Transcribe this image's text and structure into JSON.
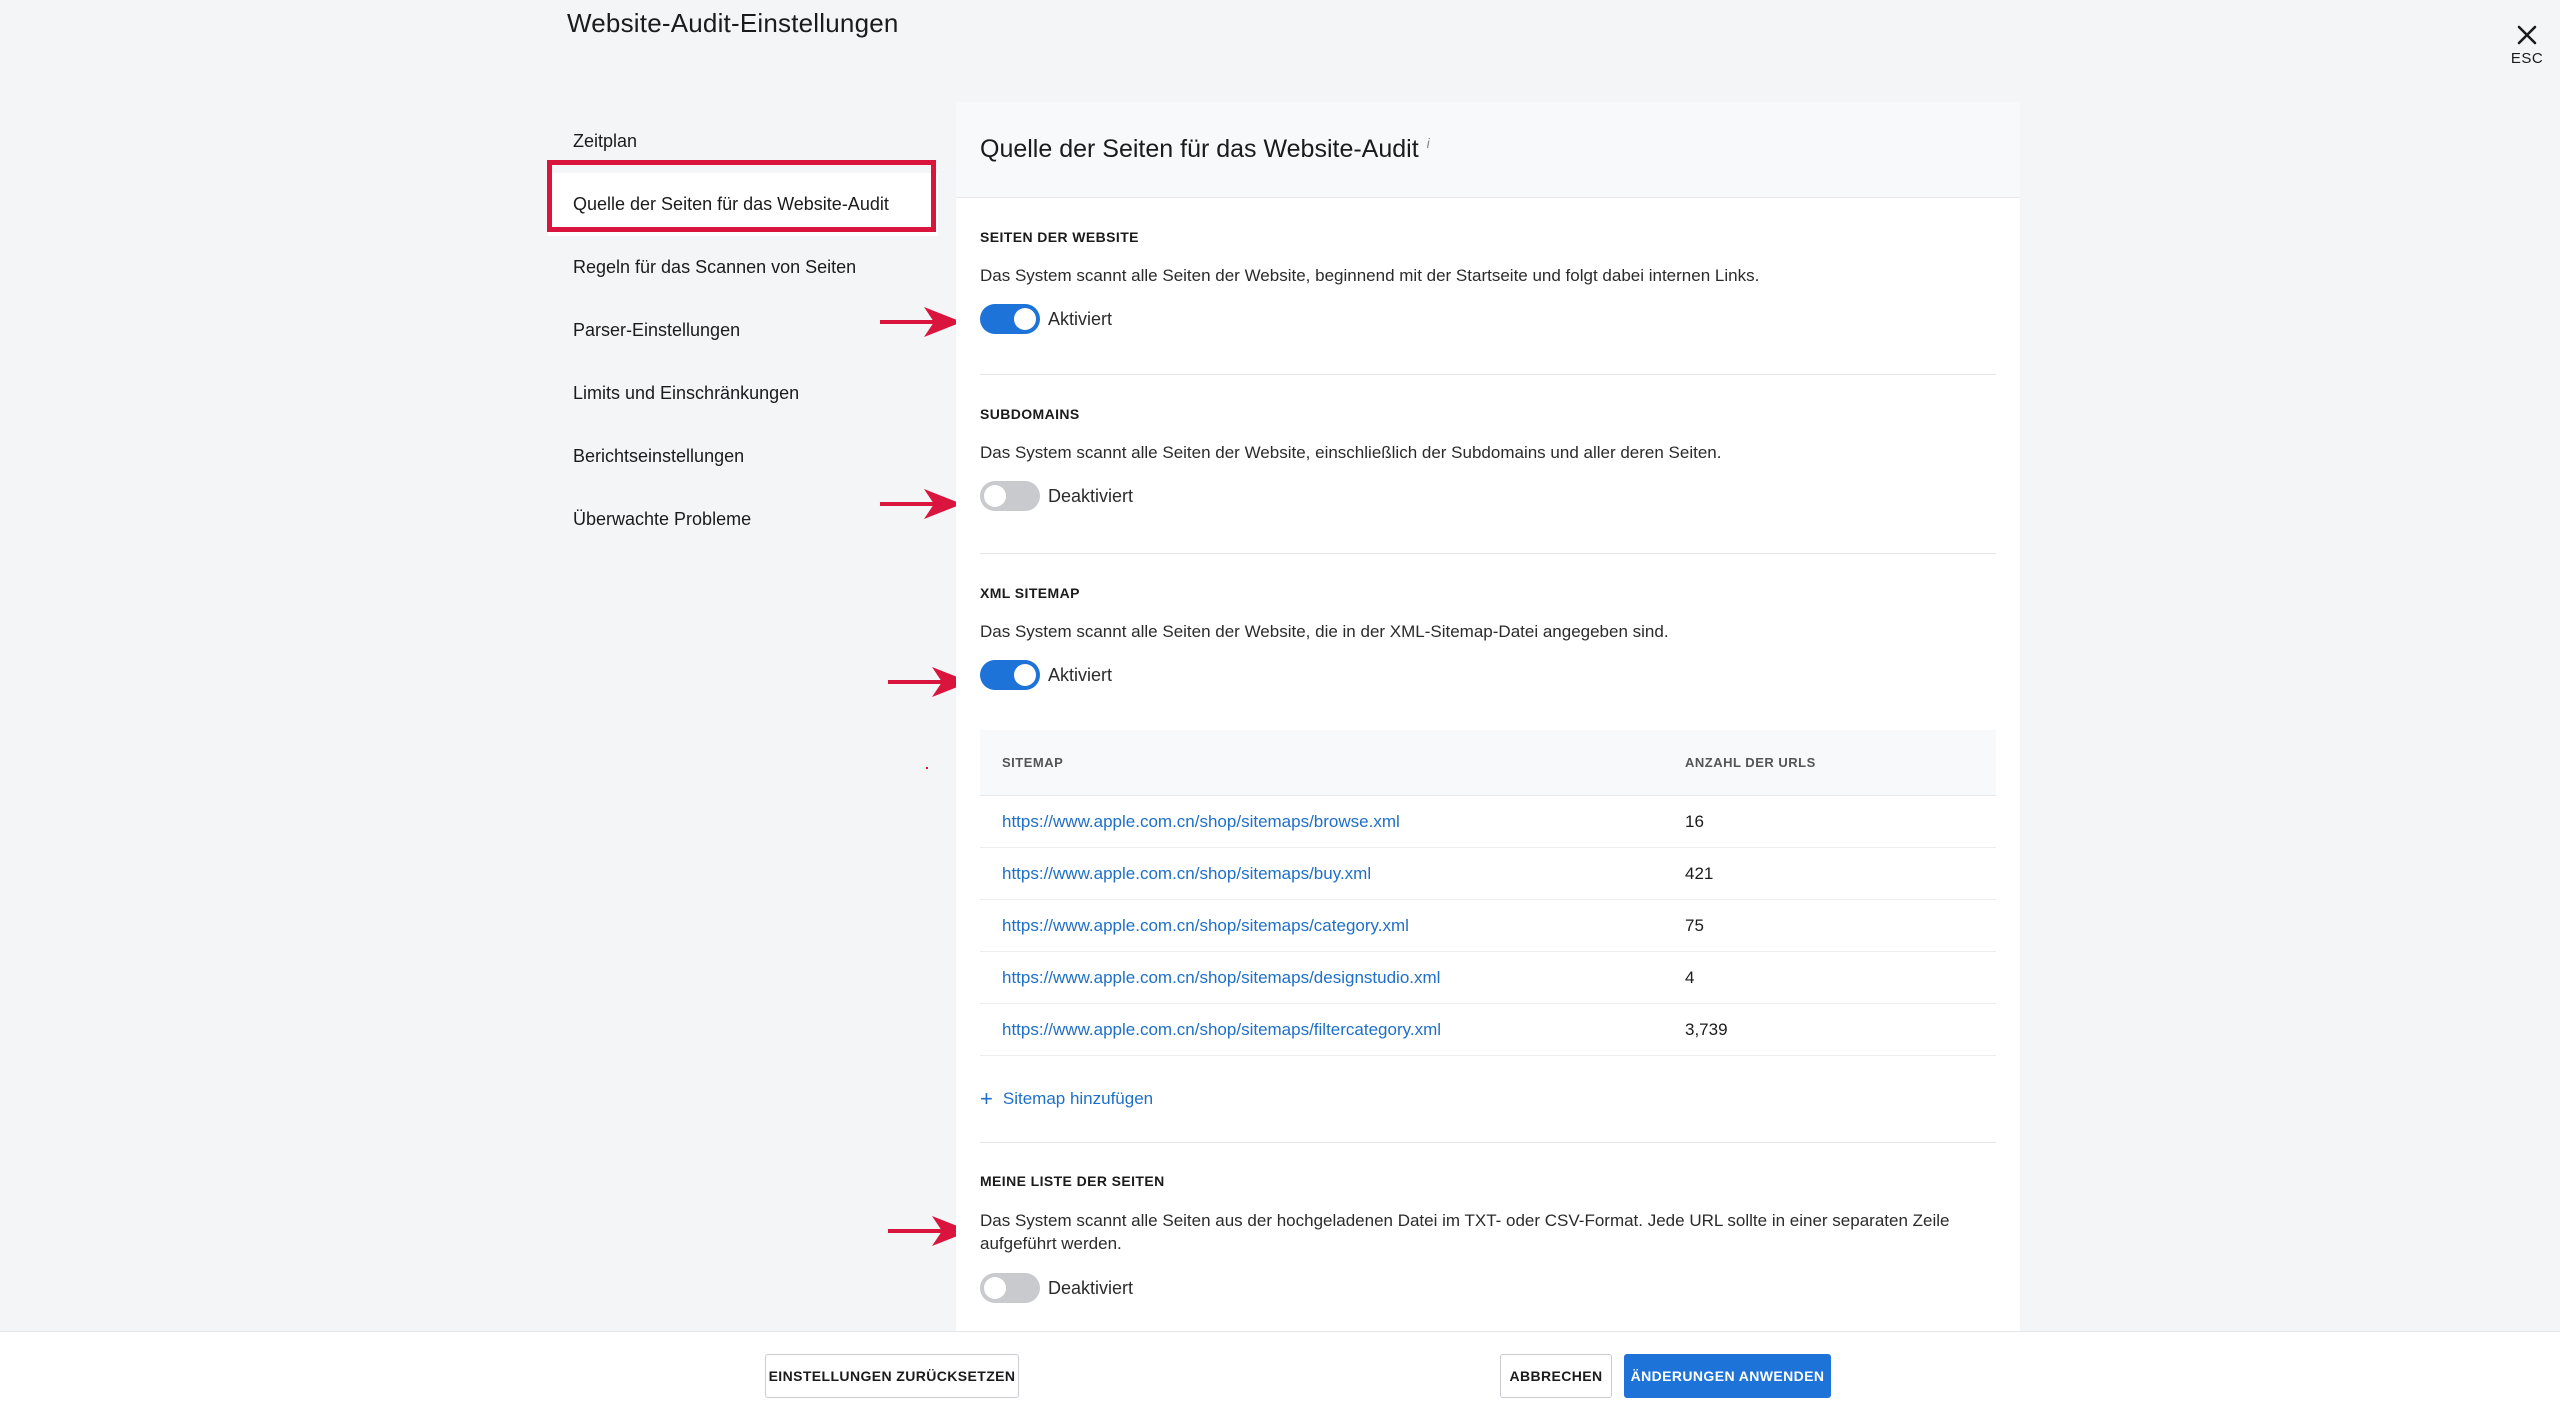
{
  "page": {
    "title": "Website-Audit-Einstellungen"
  },
  "close": {
    "label": "ESC",
    "icon": "close-icon"
  },
  "sidebar": {
    "items": [
      {
        "label": "Zeitplan"
      },
      {
        "label": "Quelle der Seiten für das Website-Audit",
        "active": true
      },
      {
        "label": "Regeln für das Scannen von Seiten"
      },
      {
        "label": "Parser-Einstellungen"
      },
      {
        "label": "Limits und Einschränkungen"
      },
      {
        "label": "Berichtseinstellungen"
      },
      {
        "label": "Überwachte Probleme"
      }
    ]
  },
  "panel": {
    "title": "Quelle der Seiten für das Website-Audit",
    "info_mark": "i",
    "sections": {
      "website": {
        "title": "SEITEN DER WEBSITE",
        "desc": "Das System scannt alle Seiten der Website, beginnend mit der Startseite und folgt dabei internen Links.",
        "toggle_label": "Aktiviert",
        "enabled": true
      },
      "subdomains": {
        "title": "SUBDOMAINS",
        "desc": "Das System scannt alle Seiten der Website, einschließlich der Subdomains und aller deren Seiten.",
        "toggle_label": "Deaktiviert",
        "enabled": false
      },
      "xml": {
        "title": "XML SITEMAP",
        "desc": "Das System scannt alle Seiten der Website, die in der XML-Sitemap-Datei angegeben sind.",
        "toggle_label": "Aktiviert",
        "enabled": true
      },
      "mylist": {
        "title": "MEINE LISTE DER SEITEN",
        "desc": "Das System scannt alle Seiten aus der hochgeladenen Datei im TXT- oder CSV-Format. Jede URL sollte in einer separaten Zeile aufgeführt werden.",
        "toggle_label": "Deaktiviert",
        "enabled": false
      }
    },
    "sitemap_table": {
      "headers": {
        "sitemap": "SITEMAP",
        "count": "ANZAHL DER URLS"
      },
      "rows": [
        {
          "url": "https://www.apple.com.cn/shop/sitemaps/browse.xml",
          "count": "16"
        },
        {
          "url": "https://www.apple.com.cn/shop/sitemaps/buy.xml",
          "count": "421"
        },
        {
          "url": "https://www.apple.com.cn/shop/sitemaps/category.xml",
          "count": "75"
        },
        {
          "url": "https://www.apple.com.cn/shop/sitemaps/designstudio.xml",
          "count": "4"
        },
        {
          "url": "https://www.apple.com.cn/shop/sitemaps/filtercategory.xml",
          "count": "3,739"
        }
      ],
      "add_label": "Sitemap hinzufügen"
    }
  },
  "footer": {
    "reset_label": "EINSTELLUNGEN ZURÜCKSETZEN",
    "cancel_label": "ABBRECHEN",
    "apply_label": "ÄNDERUNGEN ANWENDEN"
  },
  "colors": {
    "accent": "#1e73d8",
    "highlight": "#d9143d",
    "link": "#1e6fc8"
  }
}
